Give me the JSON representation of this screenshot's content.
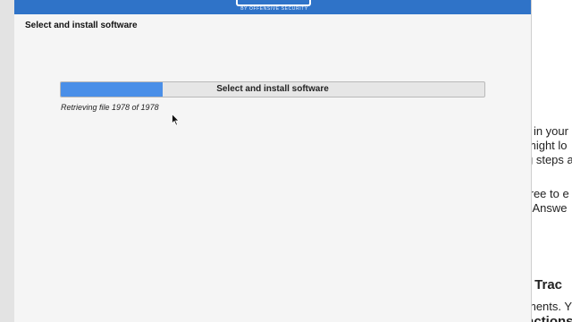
{
  "installer": {
    "banner_subtitle": "BY OFFENSIVE SECURITY",
    "page_title": "Select and install software",
    "progress": {
      "label": "Select and install software",
      "fraction": 0.24,
      "fill_color": "#4a8fe8"
    },
    "status": "Retrieving file 1978 of 1978"
  },
  "background_page": {
    "lines": [
      {
        "text": "r in your",
        "bold": false
      },
      {
        "text": "might lo",
        "bold": false
      },
      {
        "text": "g steps a",
        "bold": false
      },
      {
        "text": "free to e",
        "bold": false
      },
      {
        "text": ". Answe",
        "bold": false
      },
      {
        "text": "t Trac",
        "bold": true
      },
      {
        "text": "ments. Y",
        "bold": false
      },
      {
        "text": "actions",
        "bold": true
      }
    ]
  },
  "colors": {
    "banner": "#2f73c8",
    "window_bg": "#f5f5f5",
    "accent": "#4a8fe8"
  },
  "icons": {
    "cursor": "mouse-pointer-icon"
  }
}
